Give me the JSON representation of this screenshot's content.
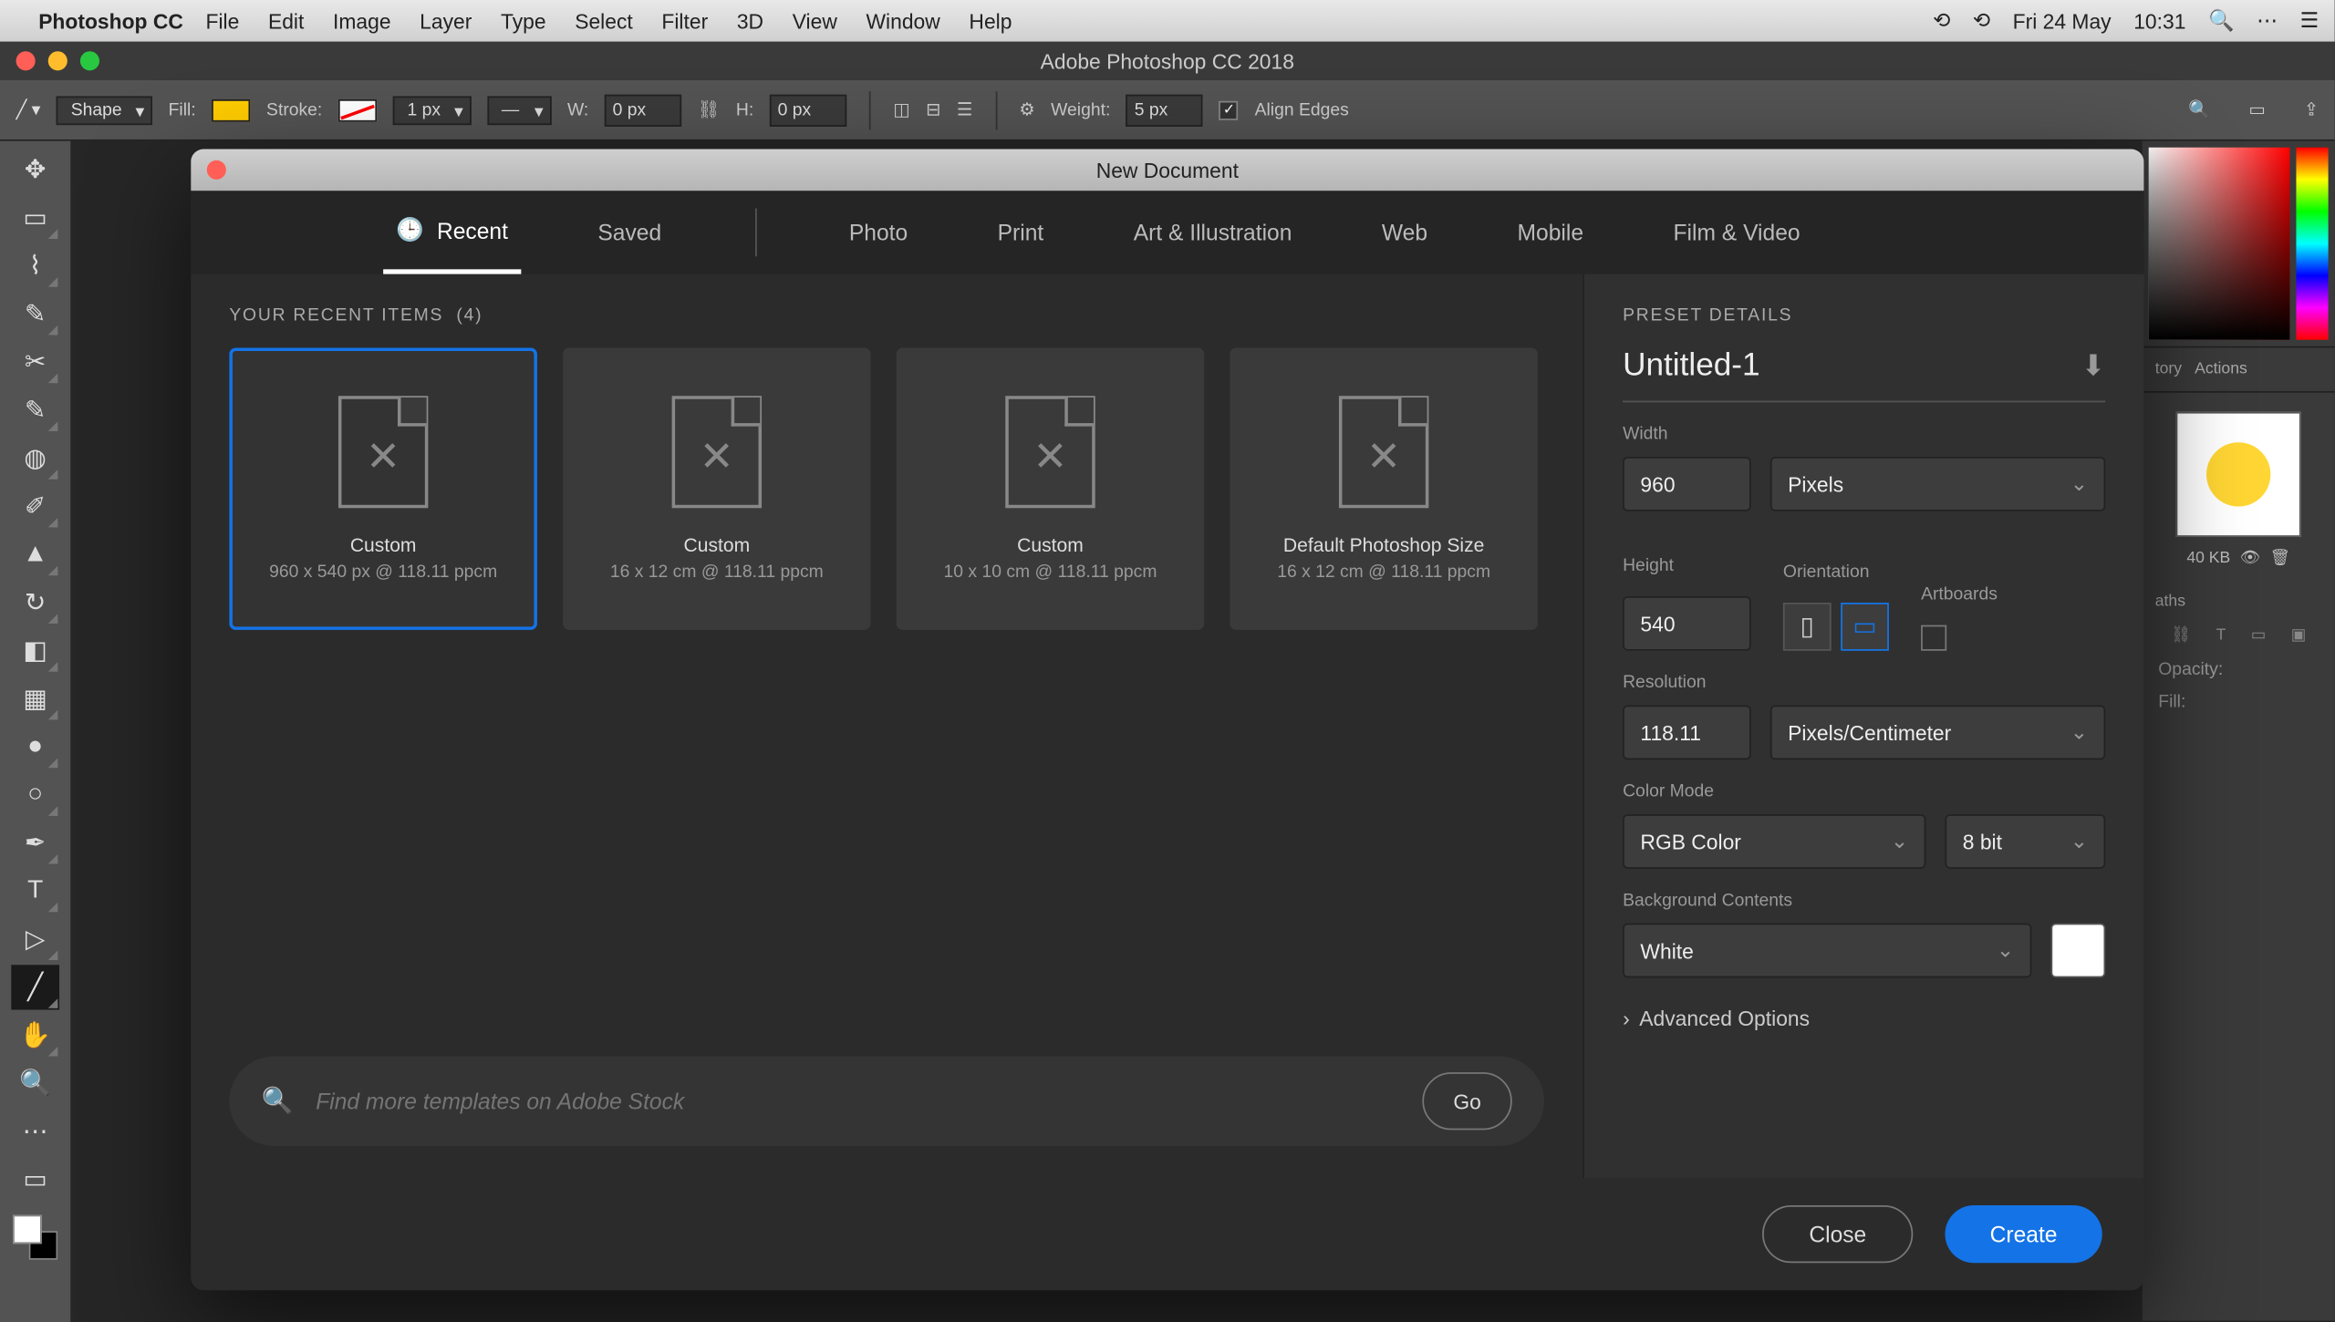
{
  "mac_menu": {
    "app_name": "Photoshop CC",
    "items": [
      "File",
      "Edit",
      "Image",
      "Layer",
      "Type",
      "Select",
      "Filter",
      "3D",
      "View",
      "Window",
      "Help"
    ],
    "date": "Fri 24 May",
    "time": "10:31"
  },
  "app_title": "Adobe Photoshop CC 2018",
  "options_bar": {
    "shape_mode": "Shape",
    "fill_label": "Fill:",
    "stroke_label": "Stroke:",
    "stroke_width": "1 px",
    "w_label": "W:",
    "w_val": "0 px",
    "h_label": "H:",
    "h_val": "0 px",
    "weight_label": "Weight:",
    "weight_val": "5 px",
    "align_edges": "Align Edges"
  },
  "right_panels": {
    "tabs1": [
      "tory",
      "Actions"
    ],
    "size": "40 KB",
    "layers_tab": "aths",
    "opacity_label": "Opacity:",
    "fill_label": "Fill:"
  },
  "dialog": {
    "title": "New Document",
    "tabs": [
      "Recent",
      "Saved",
      "Photo",
      "Print",
      "Art & Illustration",
      "Web",
      "Mobile",
      "Film & Video"
    ],
    "recent_header": "YOUR RECENT ITEMS",
    "recent_count": "(4)",
    "cards": [
      {
        "name": "Custom",
        "sub": "960 x 540 px @ 118.11 ppcm"
      },
      {
        "name": "Custom",
        "sub": "16 x 12 cm @ 118.11 ppcm"
      },
      {
        "name": "Custom",
        "sub": "10 x 10 cm @ 118.11 ppcm"
      },
      {
        "name": "Default Photoshop Size",
        "sub": "16 x 12 cm @ 118.11 ppcm"
      }
    ],
    "search_placeholder": "Find more templates on Adobe Stock",
    "go": "Go",
    "close": "Close",
    "create": "Create",
    "details": {
      "header": "PRESET DETAILS",
      "name": "Untitled-1",
      "width_label": "Width",
      "width_val": "960",
      "width_unit": "Pixels",
      "height_label": "Height",
      "height_val": "540",
      "orientation_label": "Orientation",
      "artboards_label": "Artboards",
      "resolution_label": "Resolution",
      "resolution_val": "118.11",
      "resolution_unit": "Pixels/Centimeter",
      "color_mode_label": "Color Mode",
      "color_mode": "RGB Color",
      "bit_depth": "8 bit",
      "bg_label": "Background Contents",
      "bg_val": "White",
      "advanced": "Advanced Options"
    }
  }
}
